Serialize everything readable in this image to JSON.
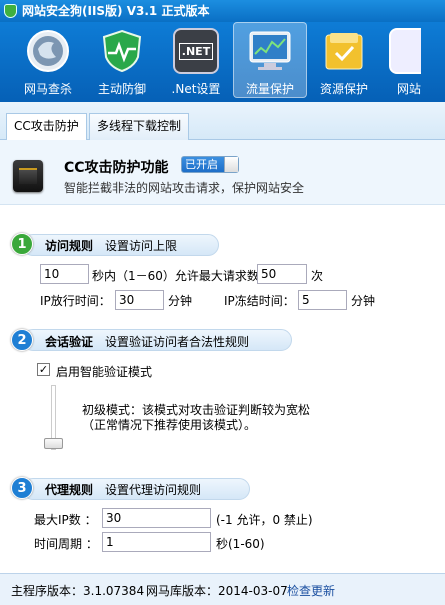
{
  "app": {
    "title": "网站安全狗(IIS版) V3.1 正式版本"
  },
  "toolbar": {
    "items": [
      {
        "label": "网马查杀",
        "icon": "globe-scan-icon"
      },
      {
        "label": "主动防御",
        "icon": "shield-monitor-icon"
      },
      {
        "label": ".Net设置",
        "icon": "dotnet-icon",
        "badge": ".NET"
      },
      {
        "label": "流量保护",
        "icon": "traffic-monitor-icon",
        "active": true
      },
      {
        "label": "资源保护",
        "icon": "folder-icon"
      },
      {
        "label": "网站",
        "icon": "website-icon"
      }
    ]
  },
  "tabs": [
    {
      "label": "CC攻击防护",
      "active": true
    },
    {
      "label": "多线程下载控制",
      "active": false
    }
  ],
  "header": {
    "title": "CC攻击防护功能",
    "status": "已开启",
    "description": "智能拦截非法的网站攻击请求，保护网站安全",
    "icon": "chip-icon"
  },
  "section1": {
    "number": "1",
    "title": "访问规则",
    "subtitle": "设置访问上限",
    "seconds_value": "10",
    "seconds_label": "秒内（1－60）允许最大请求数目",
    "max_requests_value": "50",
    "times_unit": "次",
    "ip_release_label": "IP放行时间：",
    "ip_release_value": "30",
    "ip_release_unit": "分钟",
    "ip_freeze_label": "IP冻结时间：",
    "ip_freeze_value": "5",
    "ip_freeze_unit": "分钟"
  },
  "section2": {
    "number": "2",
    "title": "会话验证",
    "subtitle": "设置验证访问者合法性规则",
    "checkbox_label": "启用智能验证模式",
    "checkbox_checked": true,
    "mode_line1": "初级模式：该模式对攻击验证判断较为宽松",
    "mode_line2": "（正常情况下推荐使用该模式）。"
  },
  "section3": {
    "number": "3",
    "title": "代理规则",
    "subtitle": "设置代理访问规则",
    "max_ip_label": "最大IP数 ：",
    "max_ip_value": "30",
    "max_ip_hint": "(-1 允许，0 禁止)",
    "period_label": "时间周期 ：",
    "period_value": "1",
    "period_unit": "秒(1-60)"
  },
  "footer": {
    "version_label": "主程序版本：3.1.07384",
    "db_label": "网马库版本：2014-03-07",
    "update_link": "检查更新"
  },
  "colors": {
    "accent": "#0a6fc4",
    "section1": "#3aa83a",
    "section2": "#1f7fd4",
    "section3": "#1f7fd4"
  }
}
